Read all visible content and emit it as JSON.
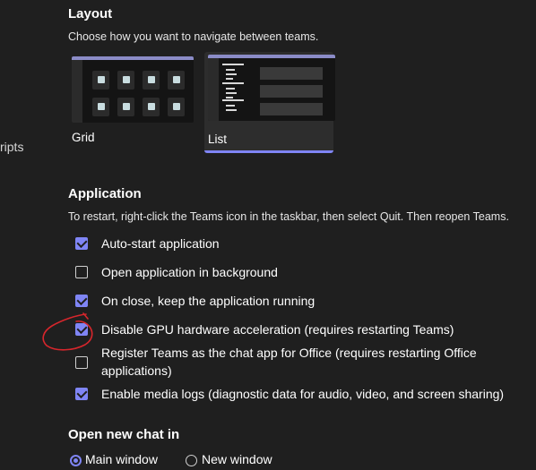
{
  "left_clip_text": "ripts",
  "layout": {
    "title": "Layout",
    "description": "Choose how you want to navigate between teams.",
    "options": [
      {
        "label": "Grid",
        "selected": false
      },
      {
        "label": "List",
        "selected": true
      }
    ]
  },
  "application": {
    "title": "Application",
    "description": "To restart, right-click the Teams icon in the taskbar, then select Quit. Then reopen Teams.",
    "options": [
      {
        "label": "Auto-start application",
        "checked": true
      },
      {
        "label": "Open application in background",
        "checked": false
      },
      {
        "label": "On close, keep the application running",
        "checked": true
      },
      {
        "label": "Disable GPU hardware acceleration (requires restarting Teams)",
        "checked": true
      },
      {
        "label": "Register Teams as the chat app for Office (requires restarting Office applications)",
        "checked": false
      },
      {
        "label": "Enable media logs (diagnostic data for audio, video, and screen sharing)",
        "checked": true
      }
    ]
  },
  "open_new_chat": {
    "title": "Open new chat in",
    "options": [
      {
        "label": "Main window",
        "selected": true
      },
      {
        "label": "New window",
        "selected": false
      }
    ]
  },
  "annotation_color": "#d7262c",
  "colors": {
    "accent": "#7f85f5",
    "background": "#1f1f1f",
    "card_selected_bg": "#2d2d2d"
  }
}
